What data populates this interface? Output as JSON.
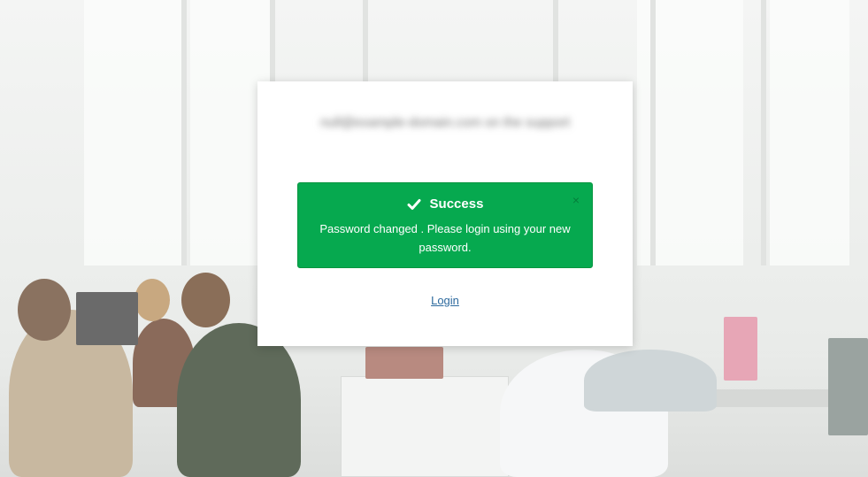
{
  "card": {
    "account_email_blurred": "null@example-domain.com on the support",
    "alert": {
      "icon": "check-icon",
      "title": "Success",
      "message": "Password changed . Please login using your new password.",
      "close_symbol": "×",
      "color": "#06a94f"
    },
    "login_link": "Login"
  }
}
